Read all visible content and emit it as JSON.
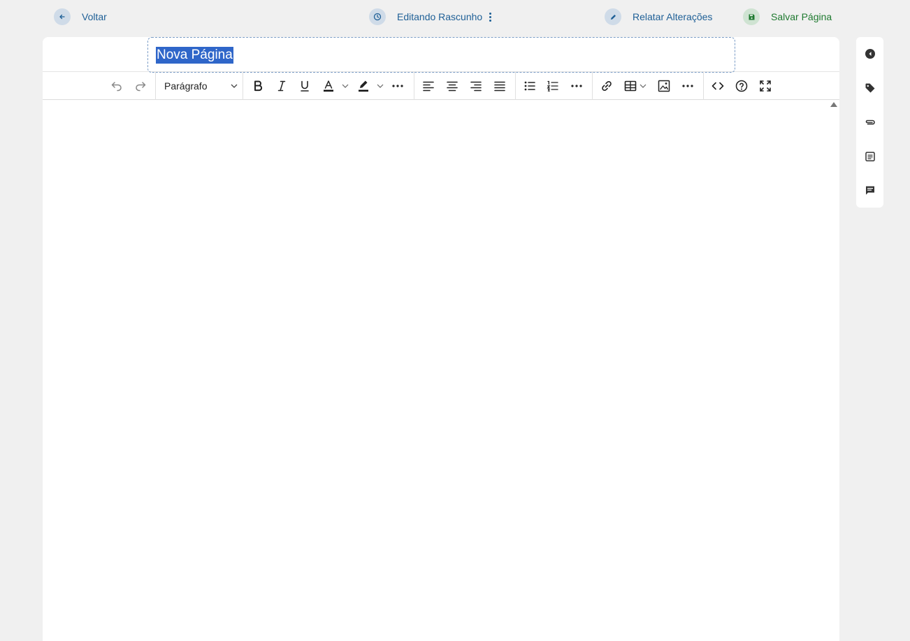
{
  "topbar": {
    "back_label": "Voltar",
    "status_label": "Editando Rascunho",
    "report_label": "Relatar Alterações",
    "save_label": "Salvar Página"
  },
  "editor": {
    "title_value": "Nova Página",
    "block_format": "Parágrafo"
  },
  "icons": {
    "back": "arrow-left-icon",
    "status": "clock-icon",
    "menu": "kebab-menu-icon",
    "report": "pencil-icon",
    "save": "floppy-disk-icon",
    "sidebar": [
      "chevron-left-circle-icon",
      "tag-icon",
      "paperclip-icon",
      "properties-icon",
      "comment-icon"
    ]
  },
  "colors": {
    "accent_blue": "#1e5f96",
    "save_green": "#1f7a30",
    "selection": "#2f66c9"
  }
}
